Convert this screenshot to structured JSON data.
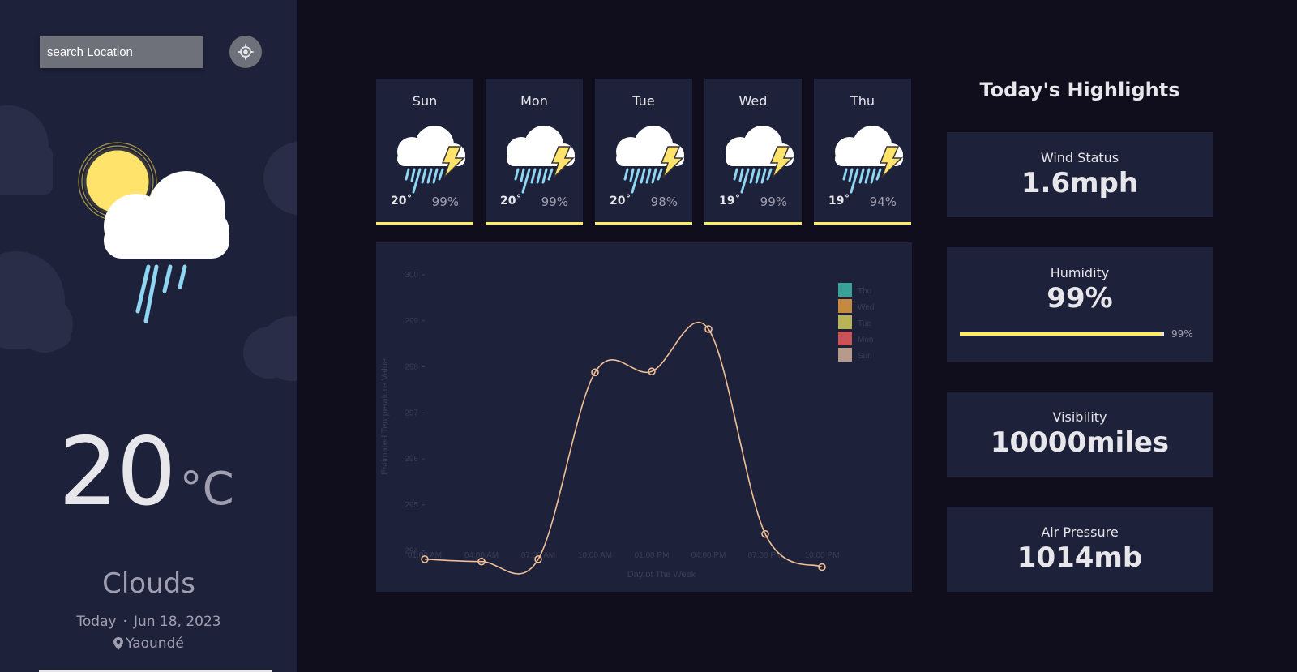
{
  "search": {
    "placeholder": "search Location"
  },
  "current": {
    "temperature": "20",
    "unit": "°C",
    "condition": "Clouds",
    "today_label": "Today",
    "separator": "·",
    "date": "Jun 18, 2023",
    "location": "Yaoundé"
  },
  "forecast": [
    {
      "day": "Sun",
      "temp": "20˚",
      "humidity": "99%"
    },
    {
      "day": "Mon",
      "temp": "20˚",
      "humidity": "99%"
    },
    {
      "day": "Tue",
      "temp": "20˚",
      "humidity": "98%"
    },
    {
      "day": "Wed",
      "temp": "19˚",
      "humidity": "99%"
    },
    {
      "day": "Thu",
      "temp": "19˚",
      "humidity": "94%"
    }
  ],
  "highlights": {
    "title": "Today's Highlights",
    "wind": {
      "label": "Wind Status",
      "value": "1.6mph"
    },
    "humidity": {
      "label": "Humidity",
      "value": "99%",
      "bar_label": "99%",
      "fraction": 0.99
    },
    "visibility": {
      "label": "Visibility",
      "value": "10000miles"
    },
    "pressure": {
      "label": "Air Pressure",
      "value": "1014mb"
    }
  },
  "colors": {
    "accent": "#ffec65",
    "panel": "#1e213a",
    "background": "#100e1d",
    "line": "#f0bf95"
  },
  "chart_data": {
    "type": "line",
    "xlabel": "Day of The Week",
    "ylabel": "Estimated Temperature Value",
    "x": [
      "01:00 AM",
      "04:00 AM",
      "07:00 AM",
      "10:00 AM",
      "01:00 PM",
      "04:00 PM",
      "07:00 PM",
      "10:00 PM"
    ],
    "ylim": [
      293.8,
      300
    ],
    "yticks": [
      294,
      295,
      296,
      297,
      298,
      299,
      300
    ],
    "series": [
      {
        "values": [
          293.82,
          293.77,
          293.82,
          297.88,
          297.9,
          298.82,
          294.37,
          293.65
        ]
      }
    ],
    "legend": [
      "Thu",
      "Wed",
      "Tue",
      "Mon",
      "Sun"
    ],
    "legend_colors": [
      "#3aa198",
      "#c48a3f",
      "#b9b35a",
      "#c8545a",
      "#b89a8a"
    ],
    "legend_position": "top-right",
    "grid": false
  }
}
